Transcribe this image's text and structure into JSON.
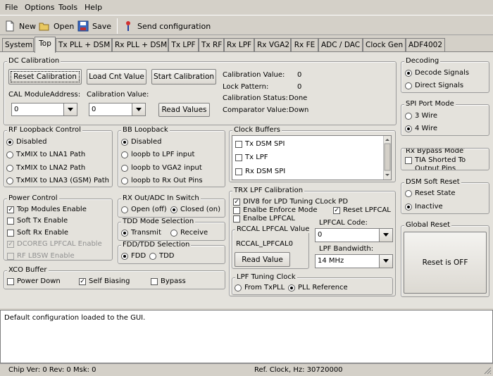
{
  "menu": [
    "File",
    "Options",
    "Tools",
    "Help"
  ],
  "toolbar": {
    "new": "New",
    "open": "Open",
    "save": "Save",
    "send": "Send configuration"
  },
  "tabs": [
    "System",
    "Top",
    "Tx PLL + DSM",
    "Rx PLL + DSM",
    "Tx LPF",
    "Tx RF",
    "Rx LPF",
    "Rx VGA2",
    "Rx FE",
    "ADC / DAC",
    "Clock Gen",
    "ADF4002"
  ],
  "dc_cal": {
    "title": "DC Calibration",
    "reset_btn": "Reset Calibration",
    "load_btn": "Load Cnt Value",
    "start_btn": "Start Calibration",
    "module_addr_label": "CAL ModuleAddress:",
    "module_addr_value": "0",
    "cal_value_label": "Calibration Value:",
    "cal_value_value": "0",
    "read_btn": "Read Values",
    "status_labels": [
      "Calibration Value:",
      "Lock Pattern:",
      "Calibration Status:",
      "Comparator Value:"
    ],
    "status_values": [
      "0",
      "0",
      "Done",
      "Down"
    ]
  },
  "decoding": {
    "title": "Decoding",
    "opt1": "Decode Signals",
    "opt2": "Direct Signals"
  },
  "spi": {
    "title": "SPI Port Mode",
    "opt1": "3 Wire",
    "opt2": "4 Wire"
  },
  "rxbypass": {
    "title": "Rx Bypass Mode",
    "opt": "TIA Shorted To Output Pins"
  },
  "dsm": {
    "title": "DSM Soft Reset",
    "opt1": "Reset State",
    "opt2": "Inactive"
  },
  "global": {
    "title": "Global Reset",
    "btn": "Reset is OFF"
  },
  "rfloop": {
    "title": "RF Loopback Control",
    "opts": [
      "Disabled",
      "TxMIX to LNA1 Path",
      "TxMIX to LNA2 Path",
      "TxMIX to LNA3 (GSM) Path"
    ]
  },
  "bbloop": {
    "title": "BB Loopback",
    "opts": [
      "Disabled",
      "loopb to LPF input",
      "loopb to VGA2 input",
      "loopb to Rx Out Pins"
    ]
  },
  "clockbuf": {
    "title": "Clock Buffers",
    "items": [
      "Tx DSM SPI",
      "Tx LPF",
      "Rx DSM SPI"
    ]
  },
  "power": {
    "title": "Power Control",
    "items": [
      "Top Modules Enable",
      "Soft Tx Enable",
      "Soft Rx Enable",
      "DCOREG LPFCAL Enable",
      "RF LBSW Enable"
    ]
  },
  "rxout": {
    "title": "RX Out/ADC In Switch",
    "opt1": "Open (off)",
    "opt2": "Closed (on)"
  },
  "tdd": {
    "title": "TDD Mode Selection",
    "opt1": "Transmit",
    "opt2": "Receive"
  },
  "fdd": {
    "title": "FDD/TDD Selection",
    "opt1": "FDD",
    "opt2": "TDD"
  },
  "xco": {
    "title": "XCO Buffer",
    "opt1": "Power Down",
    "opt2": "Self Biasing",
    "opt3": "Bypass"
  },
  "trx": {
    "title": "TRX LPF Calibration",
    "div8": "DIV8 for LPD Tuning CLock PD",
    "enforce": "Enalbe Enforce Mode",
    "reset_lpfcal": "Reset LPFCAL",
    "enable_lpfcal": "Enalbe LPFCAL",
    "rccal_title": "RCCAL LPFCAL Value",
    "rccal_label": "RCCAL_LPFCAL0",
    "read_btn": "Read Value",
    "code_label": "LPFCAL Code:",
    "code_value": "0",
    "bw_label": "LPF Bandwidth:",
    "bw_value": "14 MHz"
  },
  "lpfclock": {
    "title": "LPF Tuning Clock",
    "opt1": "From TxPLL",
    "opt2": "PLL Reference"
  },
  "log": {
    "text": "Default configuration loaded to the GUI."
  },
  "status": {
    "chip": "Chip Ver: 0 Rev: 0 Msk: 0",
    "clock": "Ref. Clock, Hz: 30720000"
  }
}
